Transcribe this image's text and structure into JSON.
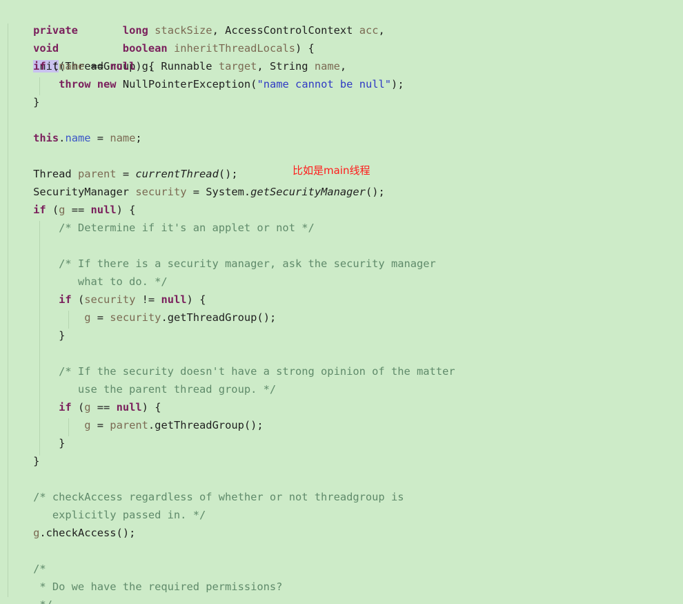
{
  "editor": {
    "lines": {
      "l1": {
        "private": "private",
        "void": "void",
        "init": "init",
        "open": "(ThreadGroup g, Runnable ",
        "target": "target",
        "mid": ", String ",
        "name": "name",
        "end": ","
      },
      "l2": {
        "indent": "                  ",
        "long": "long",
        "space": " ",
        "stackSize": "stackSize",
        "rest": ", AccessControlContext ",
        "acc": "acc",
        "end": ","
      },
      "l3": {
        "indent": "                  ",
        "boolean": "boolean",
        "space": " ",
        "inheritThreadLocals": "inheritThreadLocals",
        "end": ") {"
      },
      "l4": {
        "indent": "    ",
        "if": "if",
        "open": " (",
        "name": "name",
        "eq": " == ",
        "null": "null",
        "end": ") {"
      },
      "l5": {
        "indent": "        ",
        "throw": "throw",
        "sp1": " ",
        "new": "new",
        "sp2": " ",
        "cls": "NullPointerException(",
        "str": "\"name cannot be null\"",
        "end": ");"
      },
      "l6": {
        "text": "    }"
      },
      "l7": {
        "indent": "    ",
        "this": "this",
        "dot": ".",
        "name": "name",
        "eq": " = ",
        "value": "name",
        "end": ";"
      },
      "l8": {
        "indent": "    ",
        "type": "Thread ",
        "parent": "parent",
        "eq": " = ",
        "call": "currentThread",
        "end": "();"
      },
      "l9": {
        "indent": "    ",
        "type": "SecurityManager ",
        "security": "security",
        "eq": " = System.",
        "call": "getSecurityManager",
        "end": "();"
      },
      "l10": {
        "indent": "    ",
        "if": "if",
        "open": " (",
        "g": "g",
        "eq": " == ",
        "null": "null",
        "end": ") {"
      },
      "l11": {
        "text": "        /* Determine if it's an applet or not */"
      },
      "l12": {
        "text": "        /* If there is a security manager, ask the security manager"
      },
      "l13": {
        "text": "           what to do. */"
      },
      "l14": {
        "indent": "        ",
        "if": "if",
        "open": " (",
        "security": "security",
        "neq": " != ",
        "null": "null",
        "end": ") {"
      },
      "l15": {
        "indent": "            ",
        "g": "g",
        "eq": " = ",
        "security": "security",
        "call": ".getThreadGroup();"
      },
      "l16": {
        "text": "        }"
      },
      "l17": {
        "text": "        /* If the security doesn't have a strong opinion of the matter"
      },
      "l18": {
        "text": "           use the parent thread group. */"
      },
      "l19": {
        "indent": "        ",
        "if": "if",
        "open": " (",
        "g": "g",
        "eq": " == ",
        "null": "null",
        "end": ") {"
      },
      "l20": {
        "indent": "            ",
        "g": "g",
        "eq": " = ",
        "parent": "parent",
        "call": ".getThreadGroup();"
      },
      "l21": {
        "text": "        }"
      },
      "l22": {
        "text": "    }"
      },
      "l23": {
        "text": "    /* checkAccess regardless of whether or not threadgroup is"
      },
      "l24": {
        "text": "       explicitly passed in. */"
      },
      "l25": {
        "indent": "    ",
        "g": "g",
        "call": ".checkAccess();"
      },
      "l26": {
        "text": "    /*"
      },
      "l27": {
        "text": "     * Do we have the required permissions?"
      },
      "l28": {
        "text": "     */"
      }
    },
    "annotation": "比如是main线程",
    "colors": {
      "background": "#cdebc8",
      "keyword": "#7a1f5c",
      "parameter": "#7b6a53",
      "field": "#3b55c7",
      "string": "#2f39c4",
      "comment": "#5f8a6a",
      "highlight": "#c9c2ef",
      "annotation": "#ff1a1a"
    }
  }
}
